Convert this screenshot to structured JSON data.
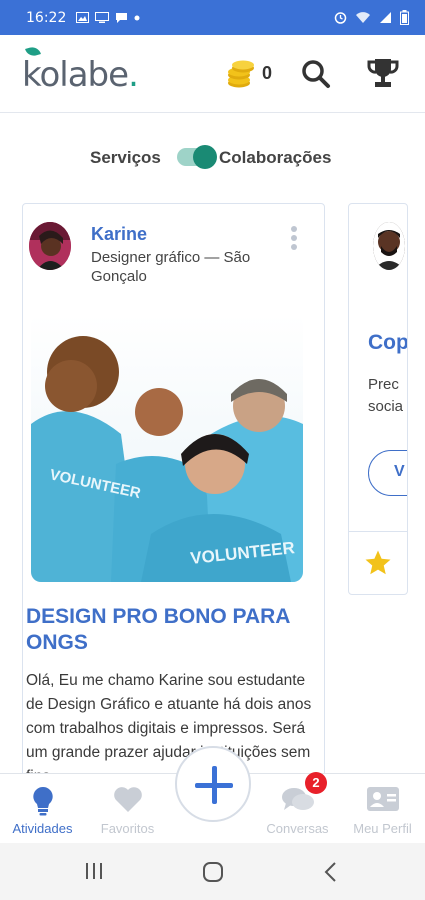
{
  "status_bar": {
    "time": "16:22"
  },
  "header": {
    "logo_text": "kolabe",
    "logo_dot": ".",
    "coin_count": "0"
  },
  "toggle": {
    "left_label": "Serviços",
    "right_label": "Colaborações",
    "state": "on"
  },
  "cards": [
    {
      "user_name": "Karine",
      "user_role": "Designer gráfico — São Gonçalo",
      "title": "DESIGN PRO BONO PARA ONGS",
      "description": "Olá, Eu me chamo Karine sou estudante de Design Gráfico e atuante há dois anos com trabalhos digitais e impressos. Será um grande prazer ajudar instituições sem fins"
    },
    {
      "title_partial": "Cop",
      "desc_line1": "Prec",
      "desc_line2": "socia",
      "button_partial": "V"
    }
  ],
  "bottom_nav": {
    "items": [
      {
        "label": "Atividades",
        "active": true
      },
      {
        "label": "Favoritos",
        "active": false
      },
      {
        "label": "Conversas",
        "active": false,
        "badge": "2"
      },
      {
        "label": "Meu Perfil",
        "active": false
      }
    ]
  },
  "colors": {
    "primary": "#3b71d6",
    "accent": "#1a8a74",
    "badge": "#e8202a",
    "coin": "#f2c21a"
  }
}
